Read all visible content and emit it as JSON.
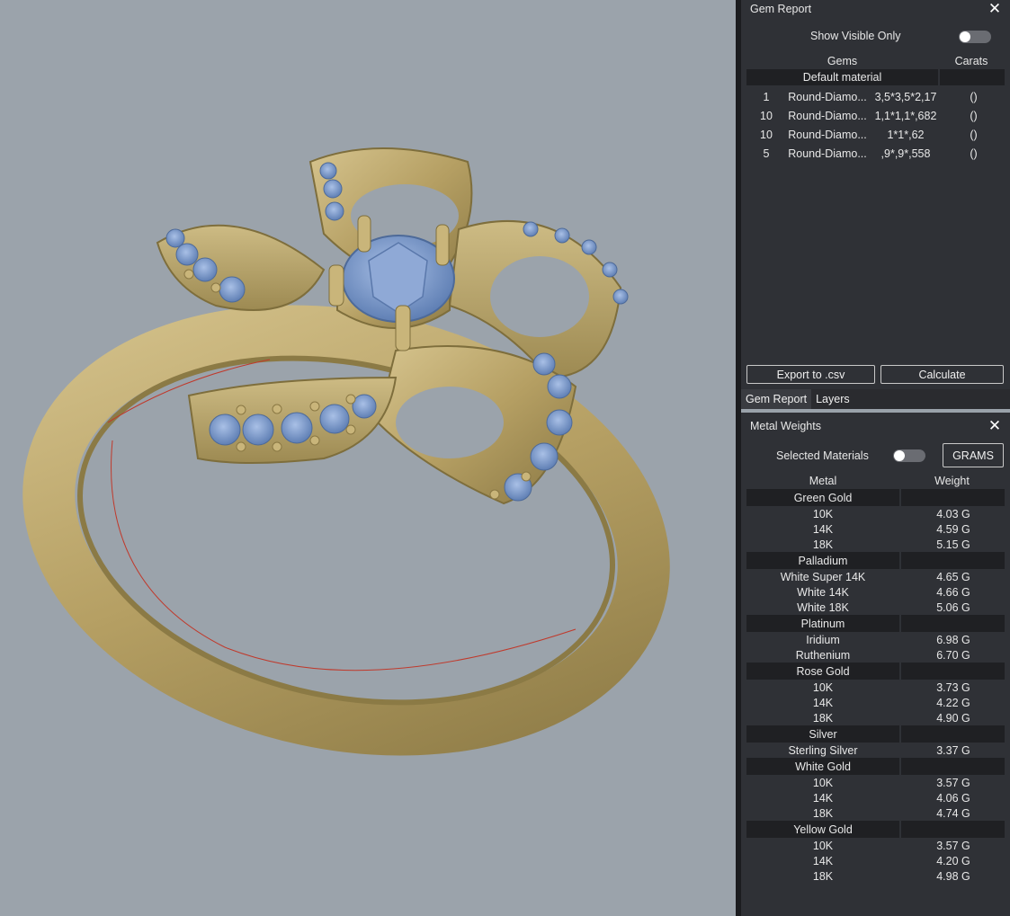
{
  "viewport": {
    "colors": {
      "background": "#9ba3ab",
      "gold": "#b8a36a",
      "gem": "#7f9fd0"
    }
  },
  "gem_report": {
    "title": "Gem Report",
    "show_visible_label": "Show Visible Only",
    "show_visible_on": false,
    "col_gems": "Gems",
    "col_carats": "Carats",
    "section": "Default material",
    "rows": [
      {
        "count": "1",
        "name": "Round-Diamo...",
        "size": "3,5*3,5*2,17",
        "carats": "()"
      },
      {
        "count": "10",
        "name": "Round-Diamo...",
        "size": "1,1*1,1*,682",
        "carats": "()"
      },
      {
        "count": "10",
        "name": "Round-Diamo...",
        "size": "1*1*,62",
        "carats": "()"
      },
      {
        "count": "5",
        "name": "Round-Diamo...",
        "size": ",9*,9*,558",
        "carats": "()"
      }
    ],
    "export_label": "Export to .csv",
    "calculate_label": "Calculate"
  },
  "tabs": [
    "Gem Report",
    "Layers"
  ],
  "metal_weights": {
    "title": "Metal Weights",
    "selected_label": "Selected Materials",
    "selected_on": false,
    "unit_button": "GRAMS",
    "col_metal": "Metal",
    "col_weight": "Weight",
    "groups": [
      {
        "name": "Green Gold",
        "items": [
          {
            "metal": "10K",
            "weight": "4.03 G"
          },
          {
            "metal": "14K",
            "weight": "4.59 G"
          },
          {
            "metal": "18K",
            "weight": "5.15 G"
          }
        ]
      },
      {
        "name": "Palladium",
        "items": [
          {
            "metal": "White Super 14K",
            "weight": "4.65 G"
          },
          {
            "metal": "White 14K",
            "weight": "4.66 G"
          },
          {
            "metal": "White 18K",
            "weight": "5.06 G"
          }
        ]
      },
      {
        "name": "Platinum",
        "items": [
          {
            "metal": "Iridium",
            "weight": "6.98 G"
          },
          {
            "metal": "Ruthenium",
            "weight": "6.70 G"
          }
        ]
      },
      {
        "name": "Rose Gold",
        "items": [
          {
            "metal": "10K",
            "weight": "3.73 G"
          },
          {
            "metal": "14K",
            "weight": "4.22 G"
          },
          {
            "metal": "18K",
            "weight": "4.90 G"
          }
        ]
      },
      {
        "name": "Silver",
        "items": [
          {
            "metal": "Sterling Silver",
            "weight": "3.37 G"
          }
        ]
      },
      {
        "name": "White Gold",
        "items": [
          {
            "metal": "10K",
            "weight": "3.57 G"
          },
          {
            "metal": "14K",
            "weight": "4.06 G"
          },
          {
            "metal": "18K",
            "weight": "4.74 G"
          }
        ]
      },
      {
        "name": "Yellow Gold",
        "items": [
          {
            "metal": "10K",
            "weight": "3.57 G"
          },
          {
            "metal": "14K",
            "weight": "4.20 G"
          },
          {
            "metal": "18K",
            "weight": "4.98 G"
          }
        ]
      }
    ]
  }
}
